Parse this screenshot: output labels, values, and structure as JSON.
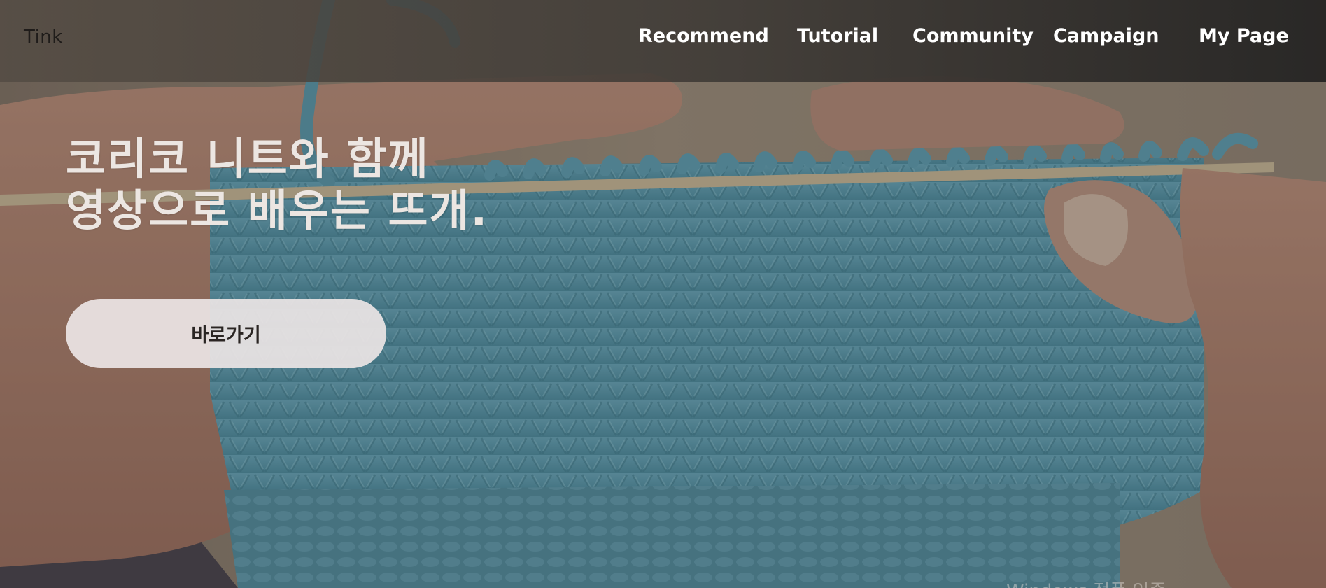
{
  "brand": {
    "name": "Tink"
  },
  "nav": {
    "items": [
      {
        "label": "Recommend"
      },
      {
        "label": "Tutorial"
      },
      {
        "label": "Community"
      },
      {
        "label": "Campaign"
      },
      {
        "label": "My Page"
      }
    ]
  },
  "hero": {
    "headline_line1": "코리코 니트와 함께",
    "headline_line2": "영상으로 배우는 뜨개.",
    "cta_label": "바로가기",
    "background_image": "knitting-hands-photo"
  },
  "watermark": {
    "text": "Windows 정품 인증"
  },
  "colors": {
    "nav_text": "#ffffff",
    "headline_text": "#ece6e2",
    "cta_background": "#ece5e5",
    "cta_text": "#2a2523",
    "yarn": "#5ea5bc",
    "needle": "#d9c9a6",
    "skin": "#b48a76"
  }
}
